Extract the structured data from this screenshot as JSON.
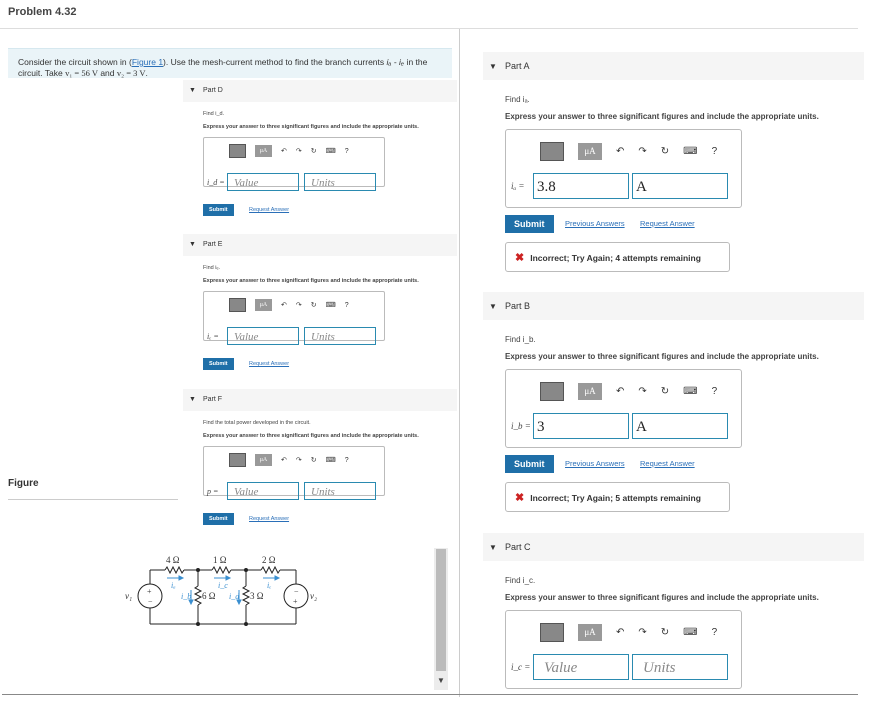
{
  "problem": {
    "title": "Problem 4.32"
  },
  "intro": {
    "pre": "Consider the circuit shown in (",
    "link": "Figure 1",
    "post": "). Use the mesh-current method to find the branch currents ",
    "ia": "iₐ",
    "dash": " - ",
    "ie": "iₑ",
    "in_the": " in the",
    "line2": "circuit. Take ",
    "v1": "v₁ = 56 V",
    "and": " and ",
    "v2": "v₂ = 3 V",
    "end": "."
  },
  "figure": {
    "label": "Figure"
  },
  "toolbar": {
    "mu_label": "μA",
    "undo": "↶",
    "redo": "↷",
    "reset": "↻",
    "keyboard": "⌨",
    "help": "?"
  },
  "common": {
    "instruction": "Express your answer to three significant figures and include the appropriate units.",
    "value_placeholder": "Value",
    "units_placeholder": "Units",
    "submit": "Submit",
    "request_answer": "Request Answer",
    "previous_answers": "Previous Answers",
    "equals": "="
  },
  "left_parts": [
    {
      "header": "Part D",
      "find": "Find i_d.",
      "var": "i_d"
    },
    {
      "header": "Part E",
      "find": "Find iₑ.",
      "var": "iₑ"
    },
    {
      "header": "Part F",
      "find": "Find the total power developed in the circuit.",
      "var": "p"
    }
  ],
  "right_parts": [
    {
      "header": "Part A",
      "find": "Find iₐ.",
      "var": "iₐ",
      "value": "3.8",
      "units": "A",
      "feedback": "Incorrect; Try Again; 4 attempts remaining"
    },
    {
      "header": "Part B",
      "find": "Find i_b.",
      "var": "i_b",
      "value": "3",
      "units": "A",
      "feedback": "Incorrect; Try Again; 5 attempts remaining"
    },
    {
      "header": "Part C",
      "find": "Find i_c.",
      "var": "i_c"
    }
  ],
  "circuit": {
    "r1": "4 Ω",
    "r2": "1 Ω",
    "r3": "2 Ω",
    "r4": "6 Ω",
    "r5": "3 Ω",
    "v1": "v₁",
    "v2": "v₂",
    "ia": "iₐ",
    "ib": "i_b",
    "ic": "i_c",
    "id": "i_d",
    "ie": "iₑ",
    "plus": "+",
    "minus": "−"
  }
}
